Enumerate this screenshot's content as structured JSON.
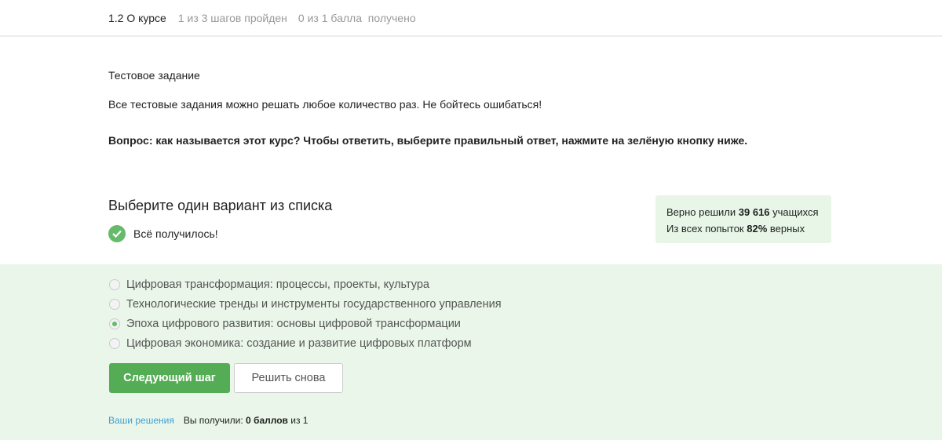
{
  "header": {
    "lesson": "1.2 О курсе",
    "steps": "1 из 3 шагов пройден",
    "points": "0 из 1 балла  получено"
  },
  "content": {
    "title": "Тестовое задание",
    "text": "Все тестовые задания можно решать любое количество раз. Не бойтесь ошибаться!",
    "question": "Вопрос: как называется этот курс? Чтобы ответить, выберите правильный ответ, нажмите на зелёную кнопку ниже."
  },
  "quiz": {
    "heading": "Выберите один вариант из списка",
    "status": "Всё получилось!",
    "options": [
      {
        "label": "Цифровая трансформация: процессы, проекты, культура",
        "selected": false
      },
      {
        "label": "Технологические тренды и инструменты государственного управления",
        "selected": false
      },
      {
        "label": "Эпоха цифрового развития: основы цифровой трансформации",
        "selected": true
      },
      {
        "label": "Цифровая экономика: создание и развитие цифровых платформ",
        "selected": false
      }
    ],
    "next_label": "Следующий шаг",
    "retry_label": "Решить снова"
  },
  "stats": {
    "l1a": "Верно решили ",
    "l1b": "39 616",
    "l1c": " учащихся",
    "l2a": "Из всех попыток ",
    "l2b": "82%",
    "l2c": " верных"
  },
  "footer": {
    "link": "Ваши решения",
    "a": "Вы получили: ",
    "b": "0 баллов",
    "c": " из 1"
  }
}
